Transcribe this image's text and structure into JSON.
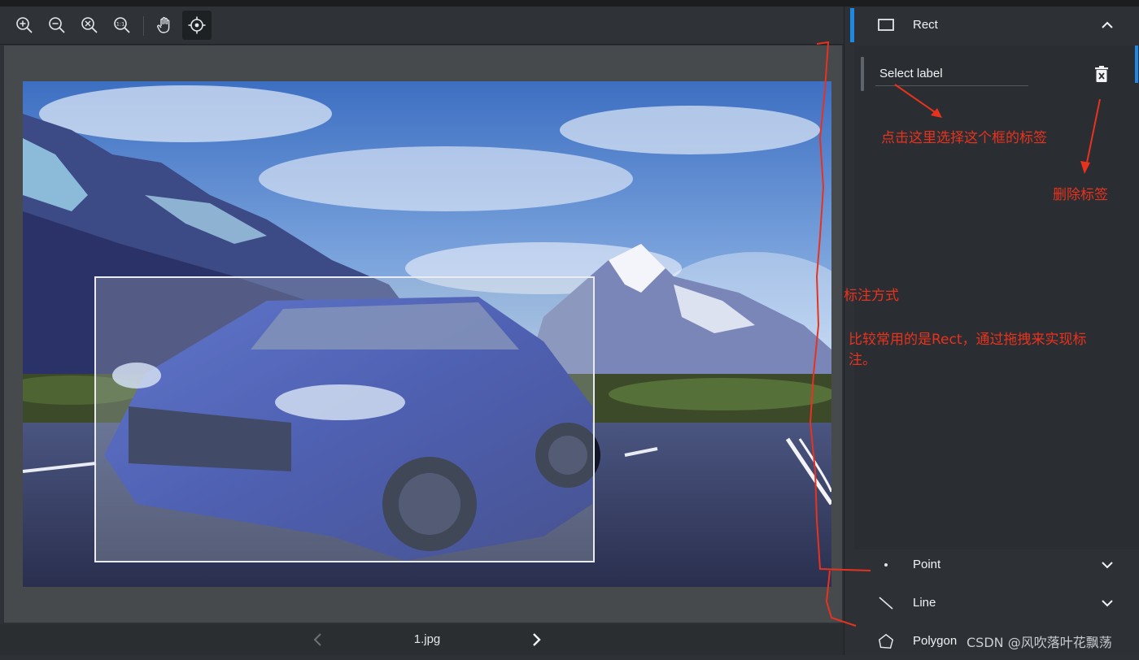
{
  "toolbar": {
    "tools": [
      {
        "name": "zoom-in-icon"
      },
      {
        "name": "zoom-out-icon"
      },
      {
        "name": "zoom-fit-icon"
      },
      {
        "name": "zoom-actual-size-icon",
        "glyph": "1:1"
      },
      {
        "name": "pan-hand-icon"
      },
      {
        "name": "crosshair-icon"
      }
    ]
  },
  "canvas": {
    "image_alt": "mountain road with blue SUV",
    "annotation_box_color": "#e9ecef"
  },
  "bottom_bar": {
    "filename": "1.jpg"
  },
  "panel": {
    "accent_color": "#1e88e5",
    "sections": {
      "rect": {
        "title": "Rect",
        "expanded": true
      },
      "point": {
        "title": "Point",
        "expanded": false
      },
      "line": {
        "title": "Line",
        "expanded": false
      },
      "polygon": {
        "title": "Polygon",
        "expanded": false
      }
    },
    "label_select": {
      "text": "Select label"
    }
  },
  "annotations": {
    "color": "#e8321e",
    "select_label_hint": "点击这里选择这个框的标签",
    "delete_label_hint": "删除标签",
    "method_title": "标注方式",
    "method_desc_line1": "比较常用的是Rect，通过拖拽来实现标",
    "method_desc_line2": "注。"
  },
  "watermark": "CSDN @风吹落叶花飘荡"
}
